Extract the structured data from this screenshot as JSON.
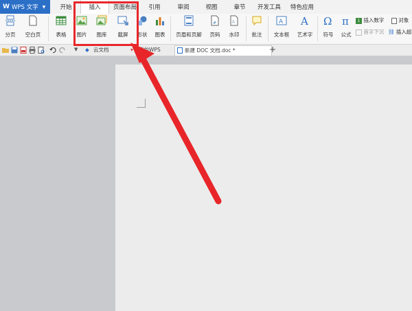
{
  "app": {
    "title": "WPS 文字"
  },
  "tabs": [
    "开始",
    "插入",
    "页面布局",
    "引用",
    "审阅",
    "视图",
    "章节",
    "开发工具",
    "特色应用"
  ],
  "active_tab": "插入",
  "ribbon": {
    "page_break": "分页",
    "blank_page": "空白页",
    "table": "表格",
    "picture": "图片",
    "gallery": "图库",
    "screenshot": "截屏",
    "shape": "形状",
    "chart": "图表",
    "header_footer": "页眉和页脚",
    "page_number": "页码",
    "watermark": "水印",
    "comment": "批注",
    "textbox": "文本框",
    "wordart": "艺术字",
    "symbol": "符号",
    "formula": "公式",
    "insert_number": "插入数字",
    "object": "对象",
    "drop_cap": "首字下沉",
    "insert_link": "插入超"
  },
  "doc_tabs": {
    "cloud": "云文档",
    "my_wps": "我的WPS",
    "current": "新建 DOC 文档.doc *",
    "new_tab": "+"
  },
  "annotation": {
    "color": "#e8262a"
  }
}
